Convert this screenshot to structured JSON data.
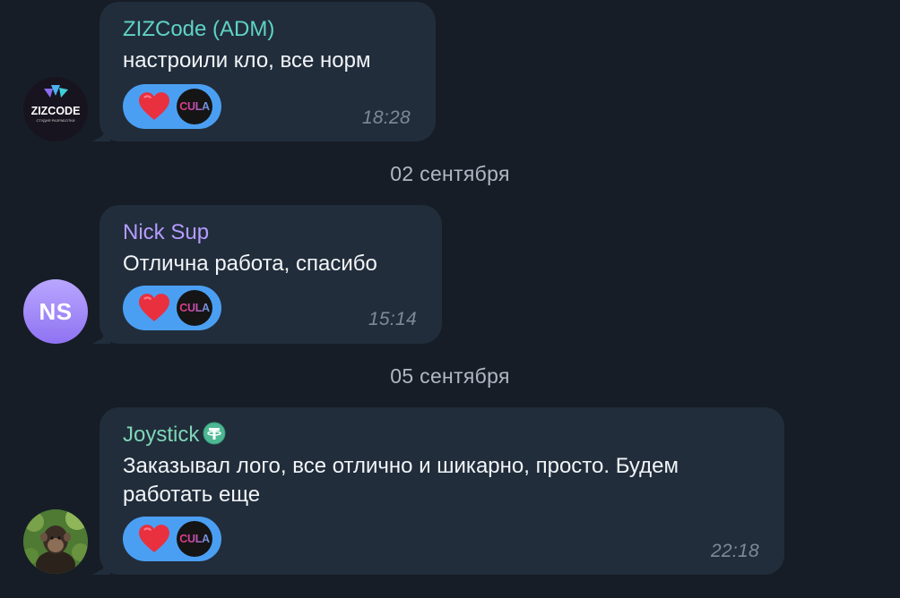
{
  "colors": {
    "background": "#161d26",
    "bubble": "#212d3b",
    "reaction_bg": "#4b9ff3",
    "timestamp": "#7d8a99",
    "date_separator": "#aeb8c3"
  },
  "messages": [
    {
      "sender": "ZIZCode (ADM)",
      "sender_color": "#5fd3c4",
      "text": "настроили кло, все норм",
      "time": "18:28",
      "avatar": {
        "type": "logo",
        "logo_text": "ZIZCODE",
        "logo_subtext": "СТУДИЯ РАЗРАБОТКИ"
      },
      "reactions": [
        {
          "icon": "heart-icon"
        },
        {
          "icon": "cula-avatar",
          "label": "CULA"
        }
      ]
    },
    {
      "sender": "Nick Sup",
      "sender_color": "#b59cff",
      "text": "Отлична работа, спасибо",
      "time": "15:14",
      "avatar": {
        "type": "initials",
        "initials": "NS"
      },
      "reactions": [
        {
          "icon": "heart-icon"
        },
        {
          "icon": "cula-avatar",
          "label": "CULA"
        }
      ]
    },
    {
      "sender": "Joystick",
      "sender_color": "#7fd6b7",
      "sender_badge_icon": "tether-icon",
      "text": "Заказывал лого, все отлично и шикарно, просто. Будем работать еще",
      "time": "22:18",
      "avatar": {
        "type": "photo",
        "icon": "monkey-photo"
      },
      "reactions": [
        {
          "icon": "heart-icon"
        },
        {
          "icon": "cula-avatar",
          "label": "CULA"
        }
      ]
    }
  ],
  "date_separators": [
    "02 сентября",
    "05 сентября"
  ]
}
